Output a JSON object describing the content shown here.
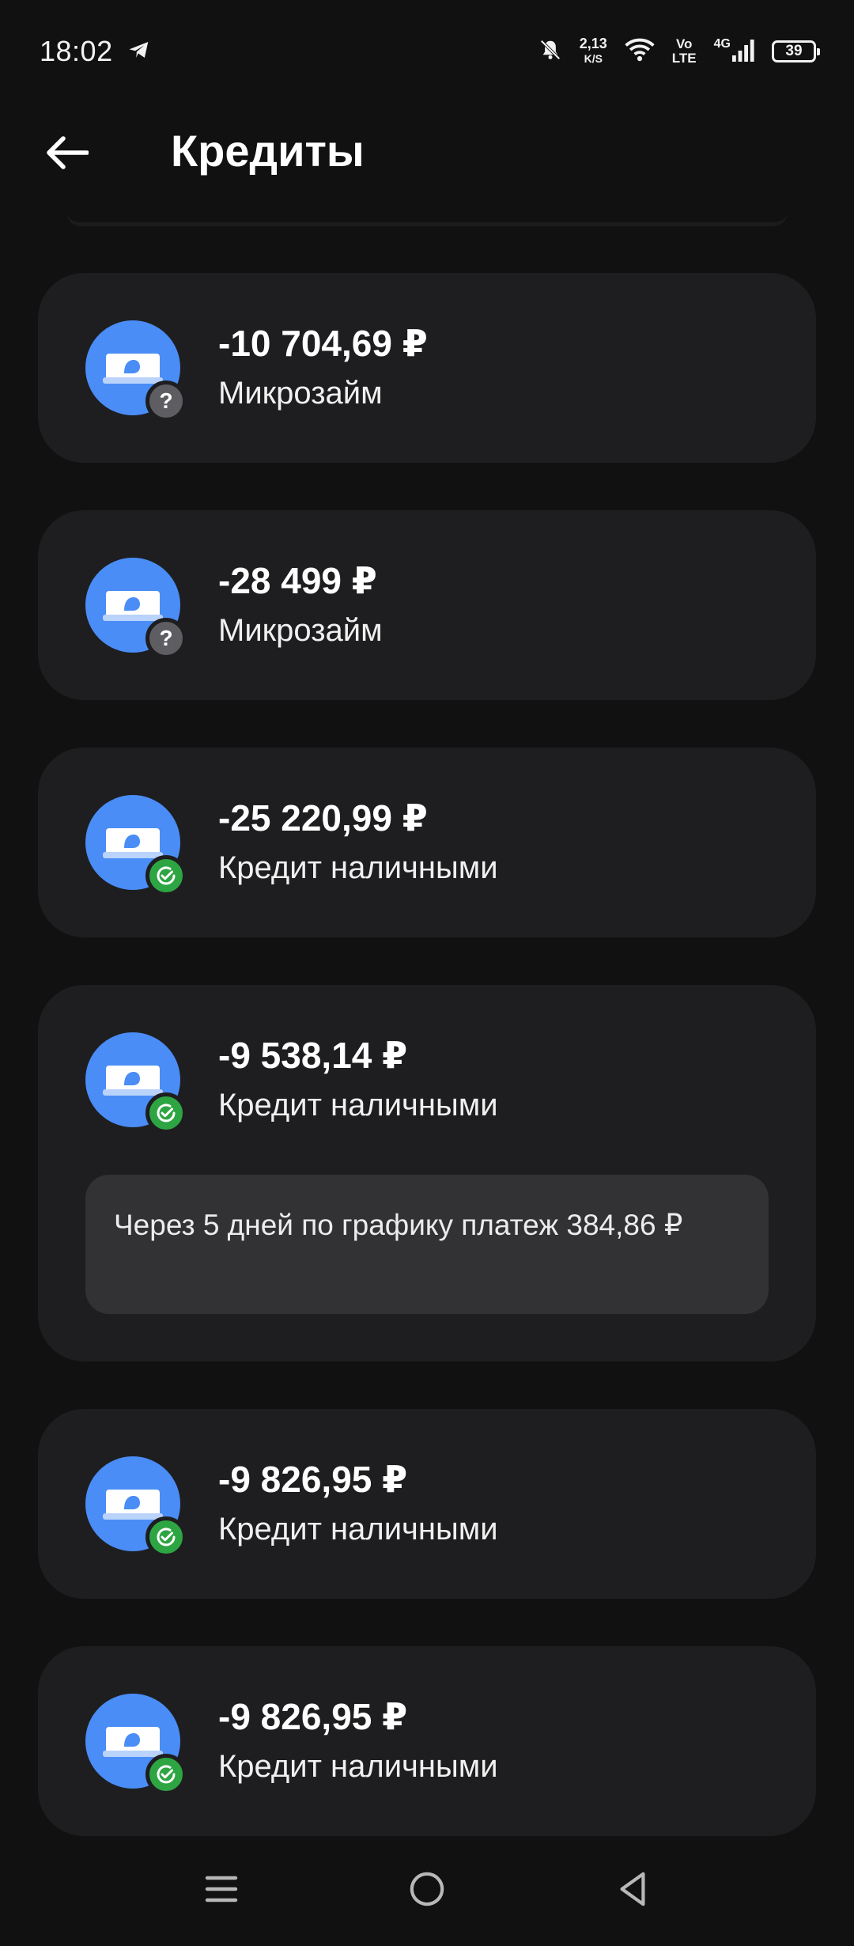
{
  "status_bar": {
    "time": "18:02",
    "speed_value": "2,13",
    "speed_unit": "K/S",
    "volte_top": "Vo",
    "volte_bottom": "LTE",
    "network": "4G",
    "battery": "39"
  },
  "header": {
    "title": "Кредиты"
  },
  "credits": [
    {
      "amount": "-10 704,69 ₽",
      "type": "Микрозайм",
      "status": "unknown"
    },
    {
      "amount": "-28 499 ₽",
      "type": "Микрозайм",
      "status": "unknown"
    },
    {
      "amount": "-25 220,99 ₽",
      "type": "Кредит наличными",
      "status": "ok"
    },
    {
      "amount": "-9 538,14 ₽",
      "type": "Кредит наличными",
      "status": "ok",
      "notice": "Через 5 дней по графику платеж 384,86 ₽"
    },
    {
      "amount": "-9 826,95 ₽",
      "type": "Кредит наличными",
      "status": "ok"
    },
    {
      "amount": "-9 826,95 ₽",
      "type": "Кредит наличными",
      "status": "ok"
    }
  ],
  "colors": {
    "background": "#111111",
    "card": "#1e1e20",
    "accent_blue": "#4a8df6",
    "status_ok": "#2ea543",
    "status_unknown": "#5e5e62"
  },
  "icons": {
    "back": "arrow-left-icon",
    "credit": "banknote-icon",
    "unknown_badge": "question-icon",
    "ok_badge": "check-circle-icon"
  }
}
